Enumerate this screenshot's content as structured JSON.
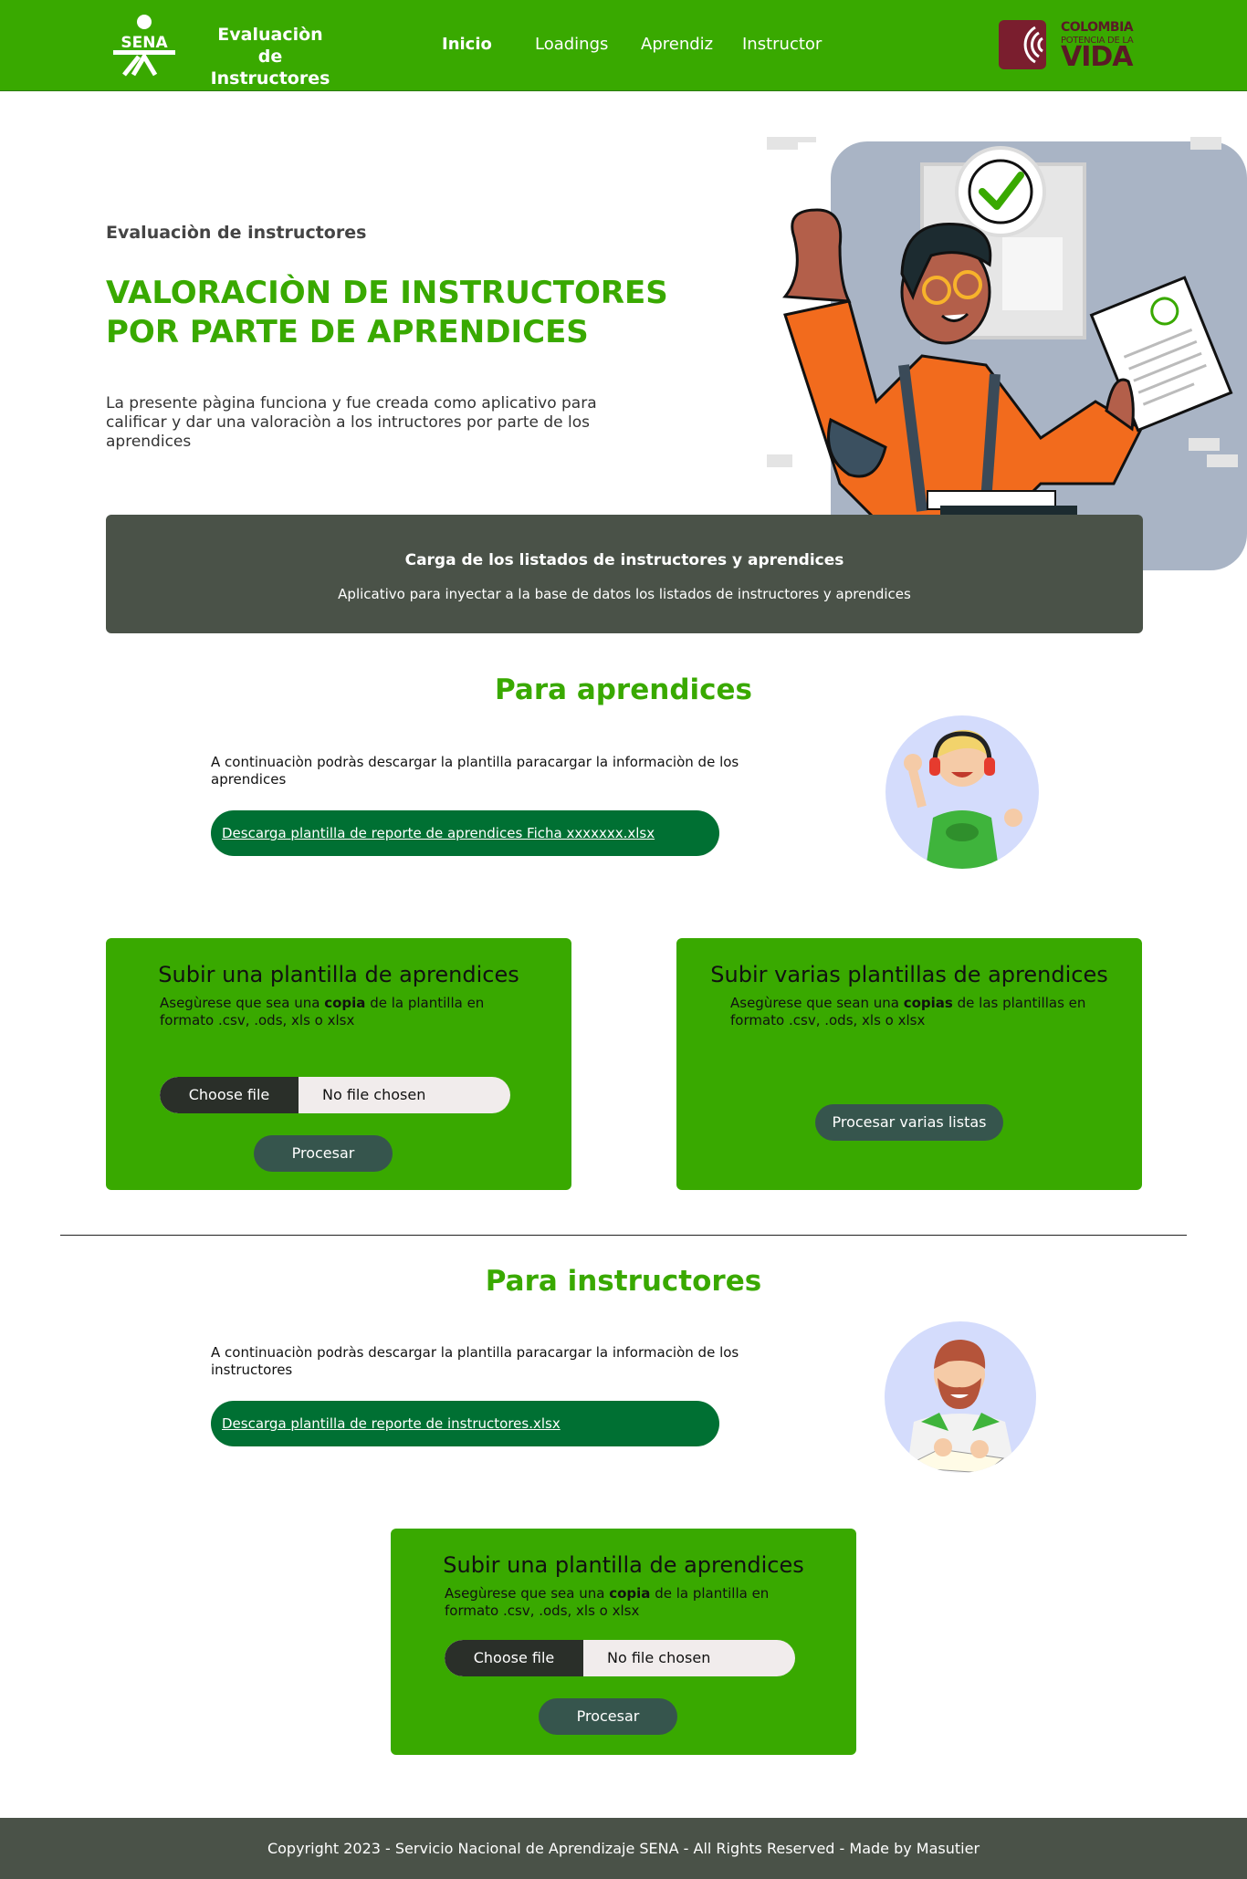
{
  "header": {
    "brand_line1": "Evaluaciòn de",
    "brand_line2": "Instructores",
    "sena_logo_text": "SENA",
    "nav": [
      {
        "label": "Inicio",
        "active": true
      },
      {
        "label": "Loadings",
        "active": false
      },
      {
        "label": "Aprendiz",
        "active": false
      },
      {
        "label": "Instructor",
        "active": false
      }
    ],
    "gov_logo": {
      "line1": "COLOMBIA",
      "line2": "POTENCIA DE LA",
      "line3": "VIDA"
    }
  },
  "hero": {
    "kicker": "Evaluaciòn de instructores",
    "title": "VALORACIÒN DE INSTRUCTORES POR PARTE DE APRENDICES",
    "description": "La presente pàgina funciona y fue creada como aplicativo para calificar y dar una valoraciòn a los intructores por parte de los aprendices"
  },
  "banner": {
    "title": "Carga de los listados de instructores y aprendices",
    "subtitle": "Aplicativo para inyectar a la base de datos los listados de instructores y aprendices"
  },
  "aprendices": {
    "section_title": "Para aprendices",
    "download_text": "A continuaciòn podràs descargar la plantilla paracargar la informaciòn de los aprendices",
    "download_button": "Descarga plantilla de reporte de aprendices Ficha xxxxxxx.xlsx",
    "single_card": {
      "title": "Subir una plantilla de aprendices",
      "note_pre": "Asegùrese que sea una ",
      "note_bold": "copia",
      "note_post": " de la plantilla en formato .csv, .ods, xls o xlsx",
      "file_button": "Choose file",
      "file_status": "No file chosen",
      "submit": "Procesar"
    },
    "multi_card": {
      "title": "Subir varias plantillas de aprendices",
      "note_pre": "Asegùrese que sean una ",
      "note_bold": "copias",
      "note_post": " de las plantillas en formato .csv, .ods, xls o xlsx",
      "submit": "Procesar varias listas"
    }
  },
  "instructores": {
    "section_title": "Para instructores",
    "download_text": " A continuaciòn podràs descargar la plantilla paracargar la informaciòn de los instructores",
    "download_button": "Descarga plantilla de reporte de instructores.xlsx",
    "card": {
      "title": "Subir una plantilla de aprendices",
      "note_pre": "Asegùrese que sea una ",
      "note_bold": "copia",
      "note_post": " de la plantilla en formato .csv, .ods, xls o xlsx",
      "file_button": "Choose file",
      "file_status": "No file chosen",
      "submit": "Procesar"
    }
  },
  "footer": {
    "text": "Copyright 2023 - Servicio Nacional de Aprendizaje SENA - All Rights Reserved - Made by Masutier"
  },
  "colors": {
    "brand_green": "#39a900",
    "dark_green_button": "#007033",
    "banner_gray": "#4a5248",
    "process_button": "#36554d"
  }
}
